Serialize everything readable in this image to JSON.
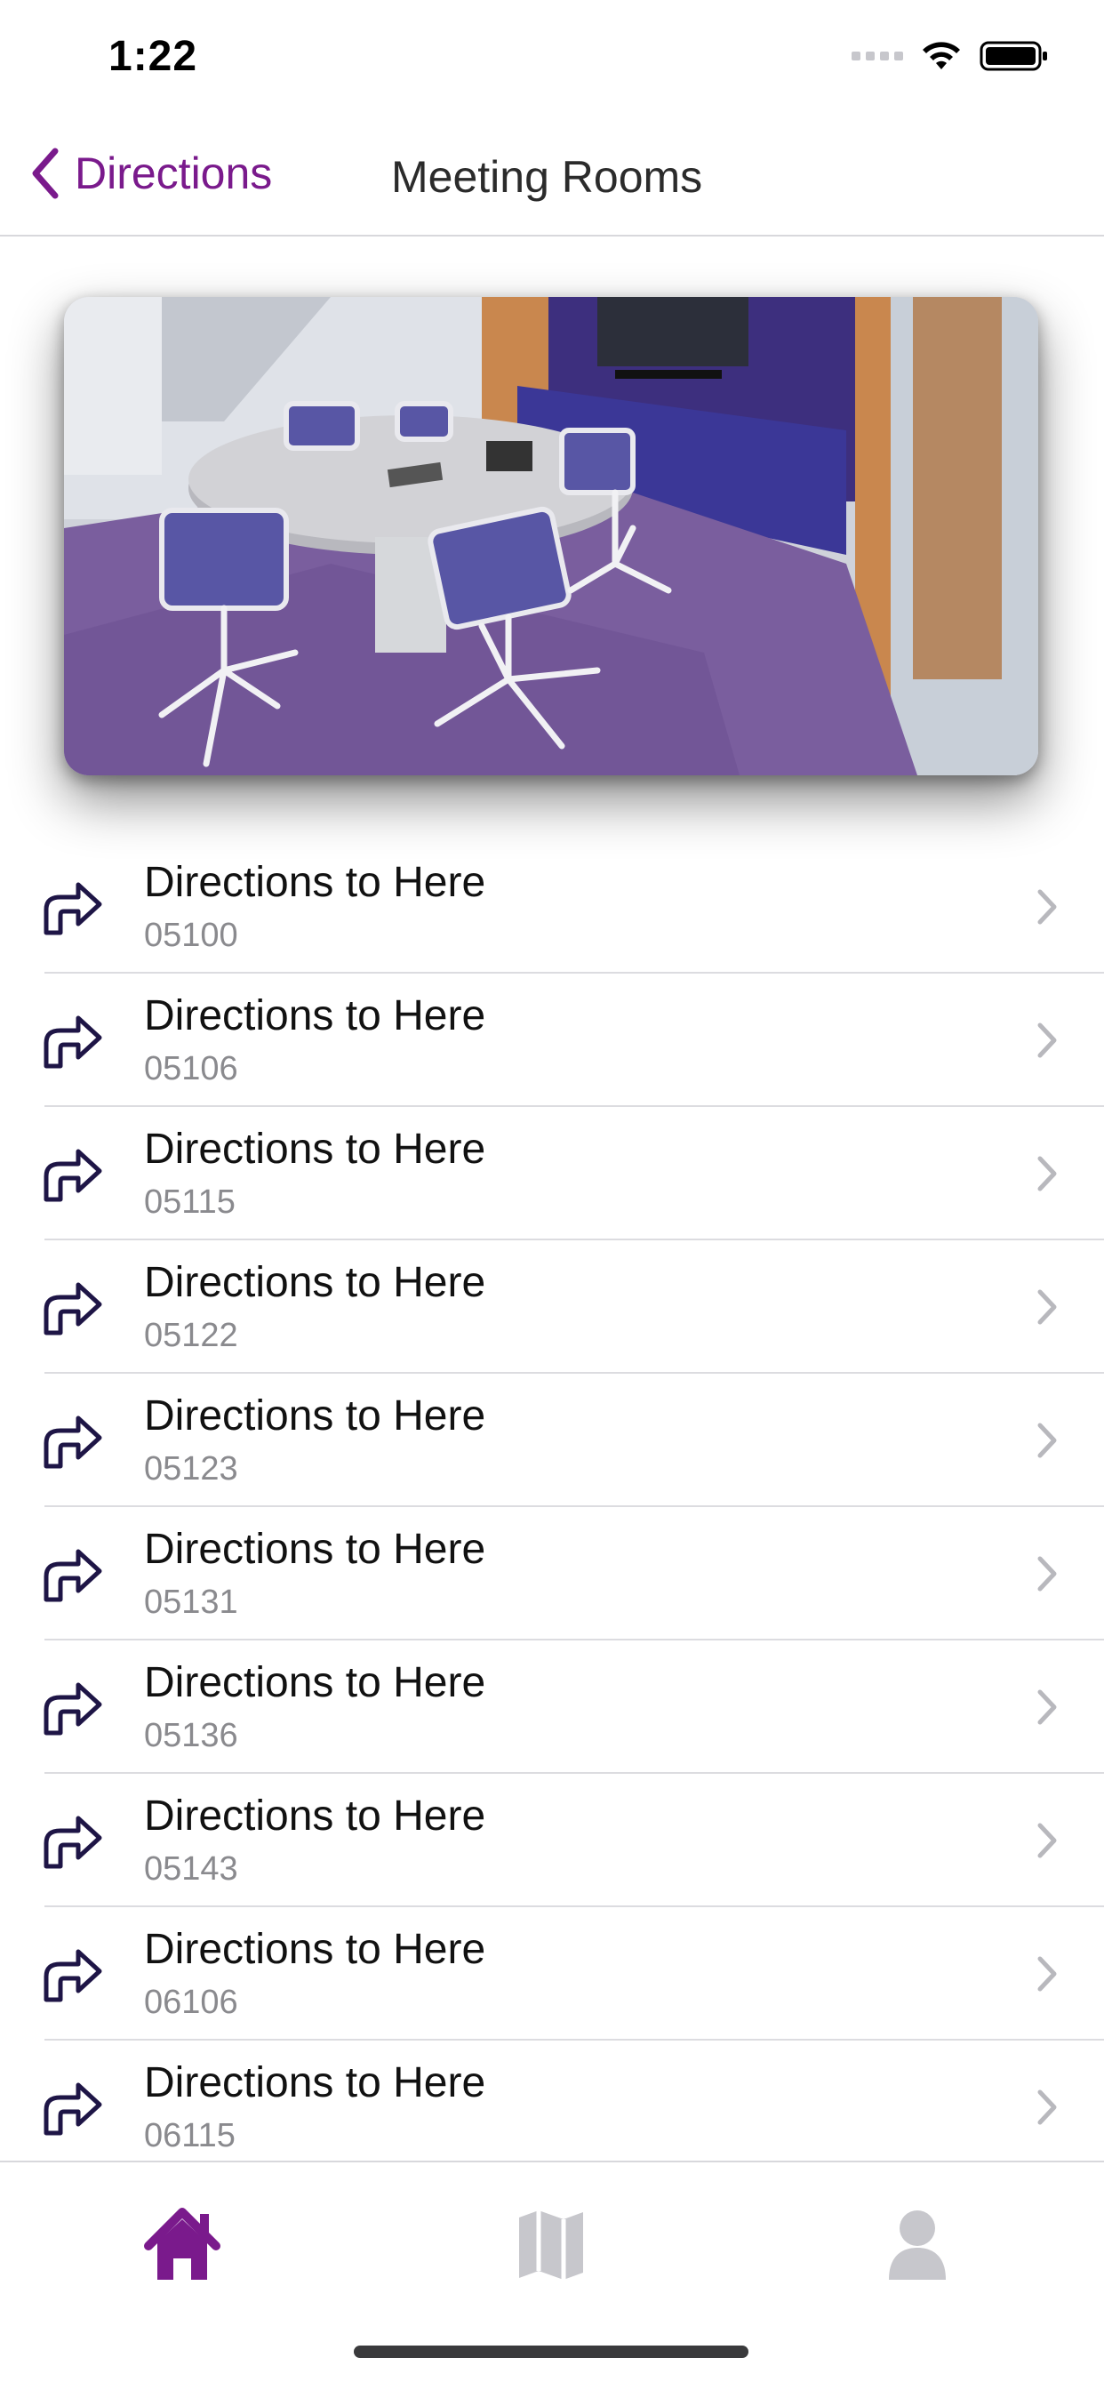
{
  "status_bar": {
    "time": "1:22"
  },
  "nav": {
    "back_label": "Directions",
    "title": "Meeting Rooms"
  },
  "colors": {
    "accent": "#7a1a8c",
    "icon_dark": "#1e1546",
    "tab_inactive": "#c7c7cc"
  },
  "hero": {
    "alt": "meeting-room-photo"
  },
  "rows": [
    {
      "title": "Directions to Here",
      "room": "05100"
    },
    {
      "title": "Directions to Here",
      "room": "05106"
    },
    {
      "title": "Directions to Here",
      "room": "05115"
    },
    {
      "title": "Directions to Here",
      "room": "05122"
    },
    {
      "title": "Directions to Here",
      "room": "05123"
    },
    {
      "title": "Directions to Here",
      "room": "05131"
    },
    {
      "title": "Directions to Here",
      "room": "05136"
    },
    {
      "title": "Directions to Here",
      "room": "05143"
    },
    {
      "title": "Directions to Here",
      "room": "06106"
    },
    {
      "title": "Directions to Here",
      "room": "06115"
    }
  ],
  "tabs": [
    {
      "icon": "home-icon",
      "active": true
    },
    {
      "icon": "map-icon",
      "active": false
    },
    {
      "icon": "person-icon",
      "active": false
    }
  ]
}
